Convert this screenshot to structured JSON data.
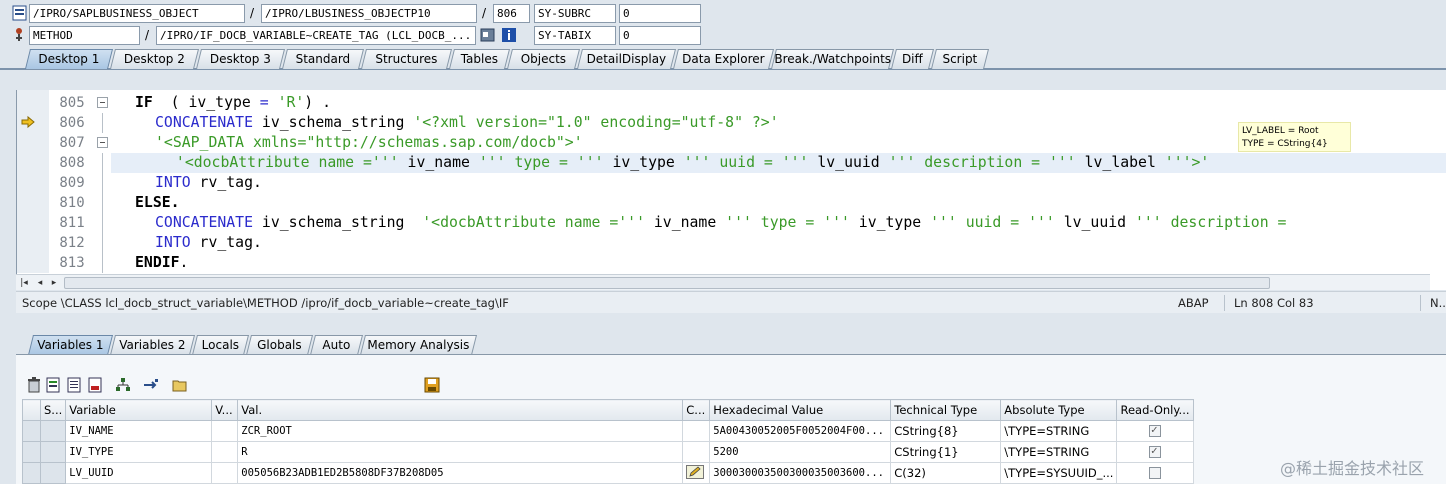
{
  "header": {
    "row1": {
      "program": "/IPRO/SAPLBUSINESS_OBJECT",
      "include": "/IPRO/LBUSINESS_OBJECTP10",
      "line": "806",
      "sysvar": "SY-SUBRC",
      "sysval": "0"
    },
    "row2": {
      "kind": "METHOD",
      "method": "/IPRO/IF_DOCB_VARIABLE~CREATE_TAG (LCL_DOCB_...",
      "sysvar": "SY-TABIX",
      "sysval": "0"
    },
    "sep": "/"
  },
  "tabs": [
    "Desktop 1",
    "Desktop 2",
    "Desktop 3",
    "Standard",
    "Structures",
    "Tables",
    "Objects",
    "DetailDisplay",
    "Data Explorer",
    "Break./Watchpoints",
    "Diff",
    "Script"
  ],
  "editor": {
    "lines": [
      {
        "no": "805",
        "segs": [
          [
            "kw",
            "IF"
          ],
          [
            "",
            "  ( iv_type "
          ],
          [
            "op",
            "="
          ],
          [
            "str",
            " 'R'"
          ],
          [
            "",
            ") ."
          ]
        ]
      },
      {
        "no": "806",
        "segs": [
          [
            "kw2",
            "CONCATENATE"
          ],
          [
            "",
            " iv_schema_string "
          ],
          [
            "str",
            "'<?xml version=\"1.0\" encoding=\"utf-8\" ?>'"
          ]
        ]
      },
      {
        "no": "807",
        "segs": [
          [
            "str",
            "'<SAP_DATA xmlns=\"http://schemas.sap.com/docb\">'"
          ]
        ]
      },
      {
        "no": "808",
        "segs": [
          [
            "str",
            " '<docbAttribute name ='''"
          ],
          [
            "",
            " iv_name "
          ],
          [
            "str",
            "''' type = '''"
          ],
          [
            "",
            " iv_type "
          ],
          [
            "str",
            "''' uuid = '''"
          ],
          [
            "",
            " lv_uuid "
          ],
          [
            "str",
            "''' description = '''"
          ],
          [
            "",
            " lv_label "
          ],
          [
            "str",
            "'''>'"
          ]
        ]
      },
      {
        "no": "809",
        "segs": [
          [
            "kw2",
            "INTO"
          ],
          [
            "",
            " rv_tag."
          ]
        ]
      },
      {
        "no": "810",
        "segs": [
          [
            "kw",
            "ELSE."
          ]
        ]
      },
      {
        "no": "811",
        "segs": [
          [
            "kw2",
            "CONCATENATE"
          ],
          [
            "",
            " iv_schema_string  "
          ],
          [
            "str",
            "'<docbAttribute name ='''"
          ],
          [
            "",
            " iv_name "
          ],
          [
            "str",
            "''' type = '''"
          ],
          [
            "",
            " iv_type "
          ],
          [
            "str",
            "''' uuid = '''"
          ],
          [
            "",
            " lv_uuid "
          ],
          [
            "str",
            "''' description = "
          ]
        ]
      },
      {
        "no": "812",
        "segs": [
          [
            "kw2",
            "INTO"
          ],
          [
            "",
            " rv_tag."
          ]
        ]
      },
      {
        "no": "813",
        "segs": [
          [
            "kw",
            "ENDIF"
          ],
          [
            "",
            "."
          ]
        ]
      }
    ],
    "tooltip": {
      "line1": "LV_LABEL = Root",
      "line2": "TYPE  = CString{4}"
    }
  },
  "status": {
    "scope": "Scope \\CLASS lcl_docb_struct_variable\\METHOD /ipro/if_docb_variable~create_tag\\IF",
    "lang": "ABAP",
    "pos": "Ln 808 Col  83",
    "mode": "N..."
  },
  "var_tabs": [
    "Variables 1",
    "Variables 2",
    "Locals",
    "Globals",
    "Auto",
    "Memory Analysis"
  ],
  "grid": {
    "columns": [
      "S...",
      "Variable",
      "V...",
      "Val.",
      "C...",
      "Hexadecimal Value",
      "Technical Type",
      "Absolute Type",
      "Read-Only..."
    ],
    "rows": [
      {
        "variable": "IV_NAME",
        "value": "ZCR_ROOT",
        "hex": "5A00430052005F0052004F00...",
        "tech": "CString{8}",
        "abs": "\\TYPE=STRING",
        "readonly": true
      },
      {
        "variable": "IV_TYPE",
        "value": "R",
        "hex": "5200",
        "tech": "CString{1}",
        "abs": "\\TYPE=STRING",
        "readonly": true
      },
      {
        "variable": "LV_UUID",
        "value": "005056B23ADB1ED2B5808DF37B208D05",
        "hex": "300030003500300035003600...",
        "tech": "C(32)",
        "abs": "\\TYPE=SYSUUID_...",
        "readonly": false
      }
    ]
  },
  "watermark": "@稀土掘金技术社区",
  "colors": {
    "accent": "#a9c6e3",
    "string": "#3a9a28",
    "keyword2": "#2b2bcc"
  }
}
